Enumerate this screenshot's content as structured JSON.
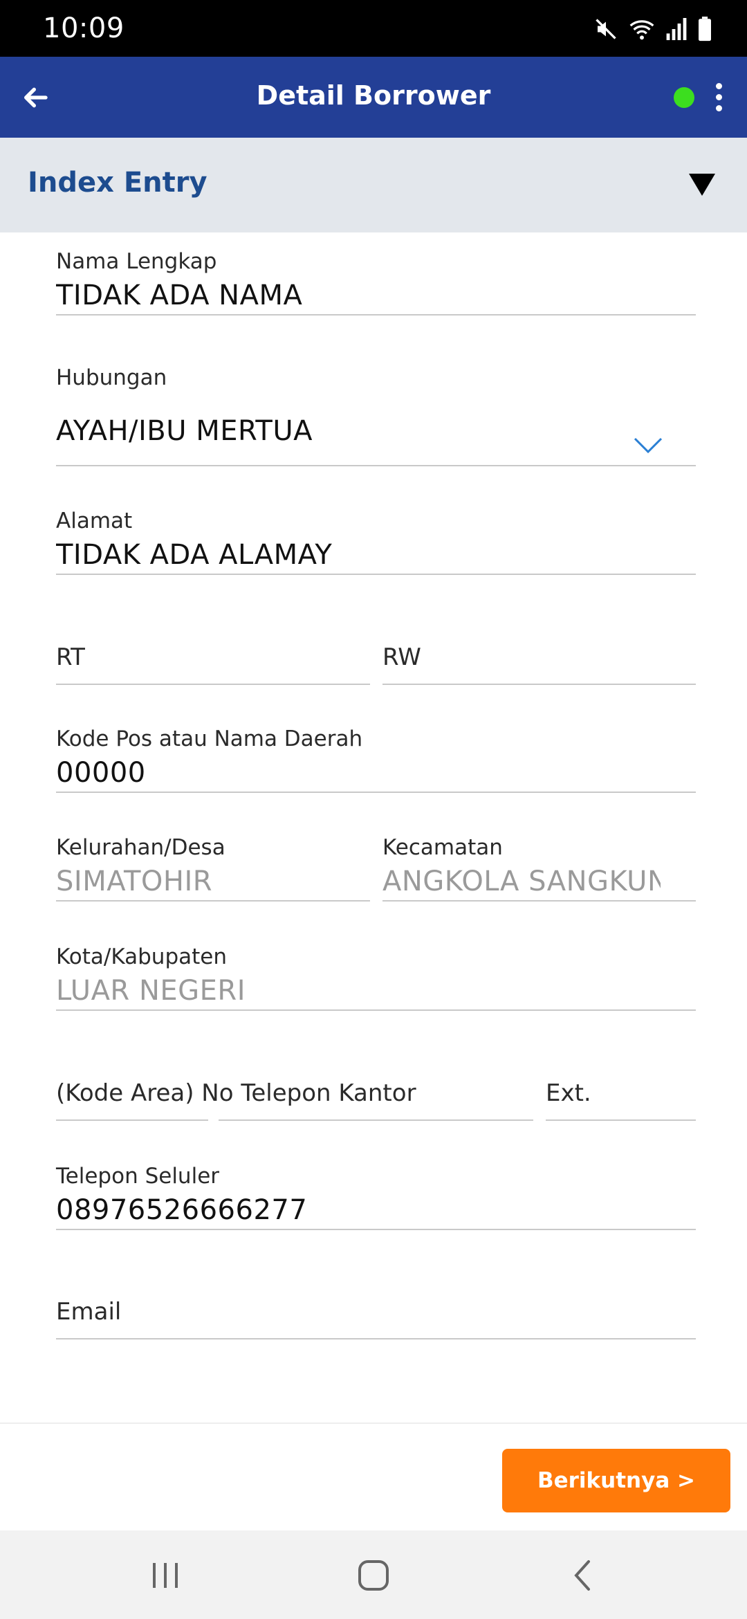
{
  "status_bar": {
    "time": "10:09",
    "icons": [
      "mute-icon",
      "wifi-icon",
      "signal-icon",
      "battery-icon"
    ]
  },
  "app_bar": {
    "title": "Detail Borrower",
    "back_icon": "arrow-left-icon",
    "status_color": "#3cde1f",
    "menu_icon": "more-vertical-icon"
  },
  "section": {
    "title": "Index Entry",
    "toggle_icon": "triangle-down-icon"
  },
  "form": {
    "nama_lengkap": {
      "label": "Nama Lengkap",
      "value": "TIDAK ADA NAMA"
    },
    "hubungan": {
      "label": "Hubungan",
      "value": "AYAH/IBU MERTUA"
    },
    "alamat": {
      "label": "Alamat",
      "value": "TIDAK ADA ALAMAY"
    },
    "rt": {
      "placeholder": "RT"
    },
    "rw": {
      "placeholder": "RW"
    },
    "kode_pos": {
      "label": "Kode Pos atau Nama Daerah",
      "value": "00000"
    },
    "kelurahan": {
      "label": "Kelurahan/Desa",
      "value": "SIMATOHIR"
    },
    "kecamatan": {
      "label": "Kecamatan",
      "value": "ANGKOLA SANGKUNUR"
    },
    "kota": {
      "label": "Kota/Kabupaten",
      "value": "LUAR NEGERI"
    },
    "telepon_kantor": {
      "placeholder": "(Kode Area) No Telepon Kantor"
    },
    "ext": {
      "placeholder": "Ext."
    },
    "telepon_seluler": {
      "label": "Telepon Seluler",
      "value": "08976526666277"
    },
    "email": {
      "placeholder": "Email"
    }
  },
  "actions": {
    "next_label": "Berikutnya >",
    "next_color": "#ff7a0a"
  },
  "colors": {
    "primary": "#233f96",
    "section_bg": "#e3e7ec",
    "section_title": "#1d4c8f"
  }
}
